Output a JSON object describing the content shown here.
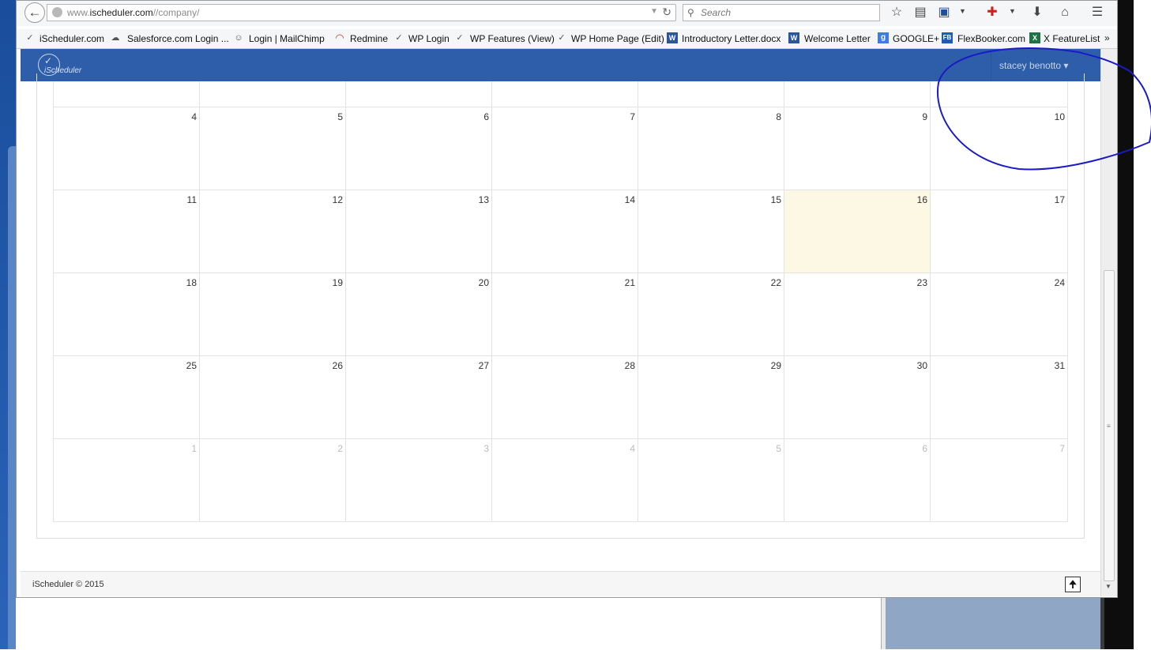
{
  "browser": {
    "url_prefix": "www.",
    "url_domain": "ischeduler.com",
    "url_path": "//company/",
    "search_placeholder": "Search"
  },
  "bookmarks": [
    {
      "label": "iScheduler.com"
    },
    {
      "label": "Salesforce.com Login ..."
    },
    {
      "label": "Login | MailChimp"
    },
    {
      "label": "Redmine"
    },
    {
      "label": "WP Login"
    },
    {
      "label": "WP Features (View)"
    },
    {
      "label": "WP Home Page (Edit)"
    },
    {
      "label": "Introductory Letter.docx"
    },
    {
      "label": "Welcome Letter"
    },
    {
      "label": "GOOGLE+"
    },
    {
      "label": "FlexBooker.com"
    },
    {
      "label": "X FeatureList"
    }
  ],
  "bookmarks_more": "»",
  "app": {
    "logo_text": "iScheduler",
    "user_name": "stacey benotto ▾"
  },
  "calendar": {
    "weeks": [
      [
        {
          "n": "4"
        },
        {
          "n": "5"
        },
        {
          "n": "6"
        },
        {
          "n": "7"
        },
        {
          "n": "8"
        },
        {
          "n": "9"
        },
        {
          "n": "10"
        }
      ],
      [
        {
          "n": "11"
        },
        {
          "n": "12"
        },
        {
          "n": "13"
        },
        {
          "n": "14"
        },
        {
          "n": "15"
        },
        {
          "n": "16",
          "today": true
        },
        {
          "n": "17"
        }
      ],
      [
        {
          "n": "18"
        },
        {
          "n": "19"
        },
        {
          "n": "20"
        },
        {
          "n": "21"
        },
        {
          "n": "22"
        },
        {
          "n": "23"
        },
        {
          "n": "24"
        }
      ],
      [
        {
          "n": "25"
        },
        {
          "n": "26"
        },
        {
          "n": "27"
        },
        {
          "n": "28"
        },
        {
          "n": "29"
        },
        {
          "n": "30"
        },
        {
          "n": "31"
        }
      ],
      [
        {
          "n": "1",
          "other": true
        },
        {
          "n": "2",
          "other": true
        },
        {
          "n": "3",
          "other": true
        },
        {
          "n": "4",
          "other": true
        },
        {
          "n": "5",
          "other": true
        },
        {
          "n": "6",
          "other": true
        },
        {
          "n": "7",
          "other": true
        }
      ]
    ]
  },
  "footer": {
    "copyright": "iScheduler © 2015"
  },
  "colors": {
    "header_bg": "#2e5ea9",
    "today_bg": "#fcf8e3",
    "annotation": "#1a1ac8"
  }
}
